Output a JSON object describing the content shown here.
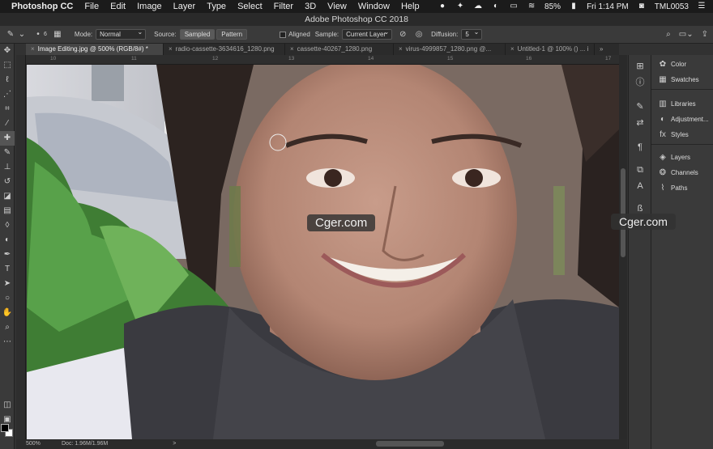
{
  "menubar": {
    "app_name": "Photoshop CC",
    "items": [
      "File",
      "Edit",
      "Image",
      "Layer",
      "Type",
      "Select",
      "Filter",
      "3D",
      "View",
      "Window",
      "Help"
    ],
    "battery": "85%",
    "clock": "Fri 1:14 PM",
    "user": "TML0053"
  },
  "window": {
    "title": "Adobe Photoshop CC 2018"
  },
  "options": {
    "brush_size": "6",
    "mode_label": "Mode:",
    "mode_value": "Normal",
    "source_label": "Source:",
    "source_sampled": "Sampled",
    "source_pattern": "Pattern",
    "aligned_label": "Aligned",
    "sample_label": "Sample:",
    "sample_value": "Current Layer",
    "diffusion_label": "Diffusion:",
    "diffusion_value": "5"
  },
  "tabs": [
    {
      "label": "Image Editing.jpg @ 500% (RGB/8#) *",
      "active": true
    },
    {
      "label": "radio-cassette-3634616_1280.png",
      "active": false
    },
    {
      "label": "cassette-40267_1280.png",
      "active": false
    },
    {
      "label": "virus-4999857_1280.png @...",
      "active": false
    },
    {
      "label": "Untitled-1 @ 100% () ... i",
      "active": false
    }
  ],
  "ruler": {
    "h_ticks": [
      "10",
      "11",
      "12",
      "13",
      "14",
      "15",
      "16",
      "17"
    ]
  },
  "status": {
    "zoom": "500%",
    "doc": "Doc: 1.96M/1.96M",
    "arrow": ">"
  },
  "watermarks": [
    "Cger.com",
    "Cger.com"
  ],
  "panels": {
    "group1": [
      "Color",
      "Swatches"
    ],
    "group2": [
      "Libraries",
      "Adjustment...",
      "Styles"
    ],
    "group3": [
      "Layers",
      "Channels",
      "Paths"
    ]
  },
  "icons": {
    "tools": [
      "move-icon",
      "marquee-icon",
      "lasso-icon",
      "quick-select-icon",
      "crop-icon",
      "eyedropper-icon",
      "healing-brush-icon",
      "brush-icon",
      "clone-stamp-icon",
      "history-brush-icon",
      "eraser-icon",
      "gradient-icon",
      "blur-icon",
      "dodge-icon",
      "pen-icon",
      "type-icon",
      "path-select-icon",
      "shape-icon",
      "hand-icon",
      "zoom-icon",
      "more-tools-icon"
    ]
  },
  "colors": {
    "menubar": "#1b1b1b",
    "panel": "#3a3a3a",
    "accent_red": "#fe5f57"
  }
}
